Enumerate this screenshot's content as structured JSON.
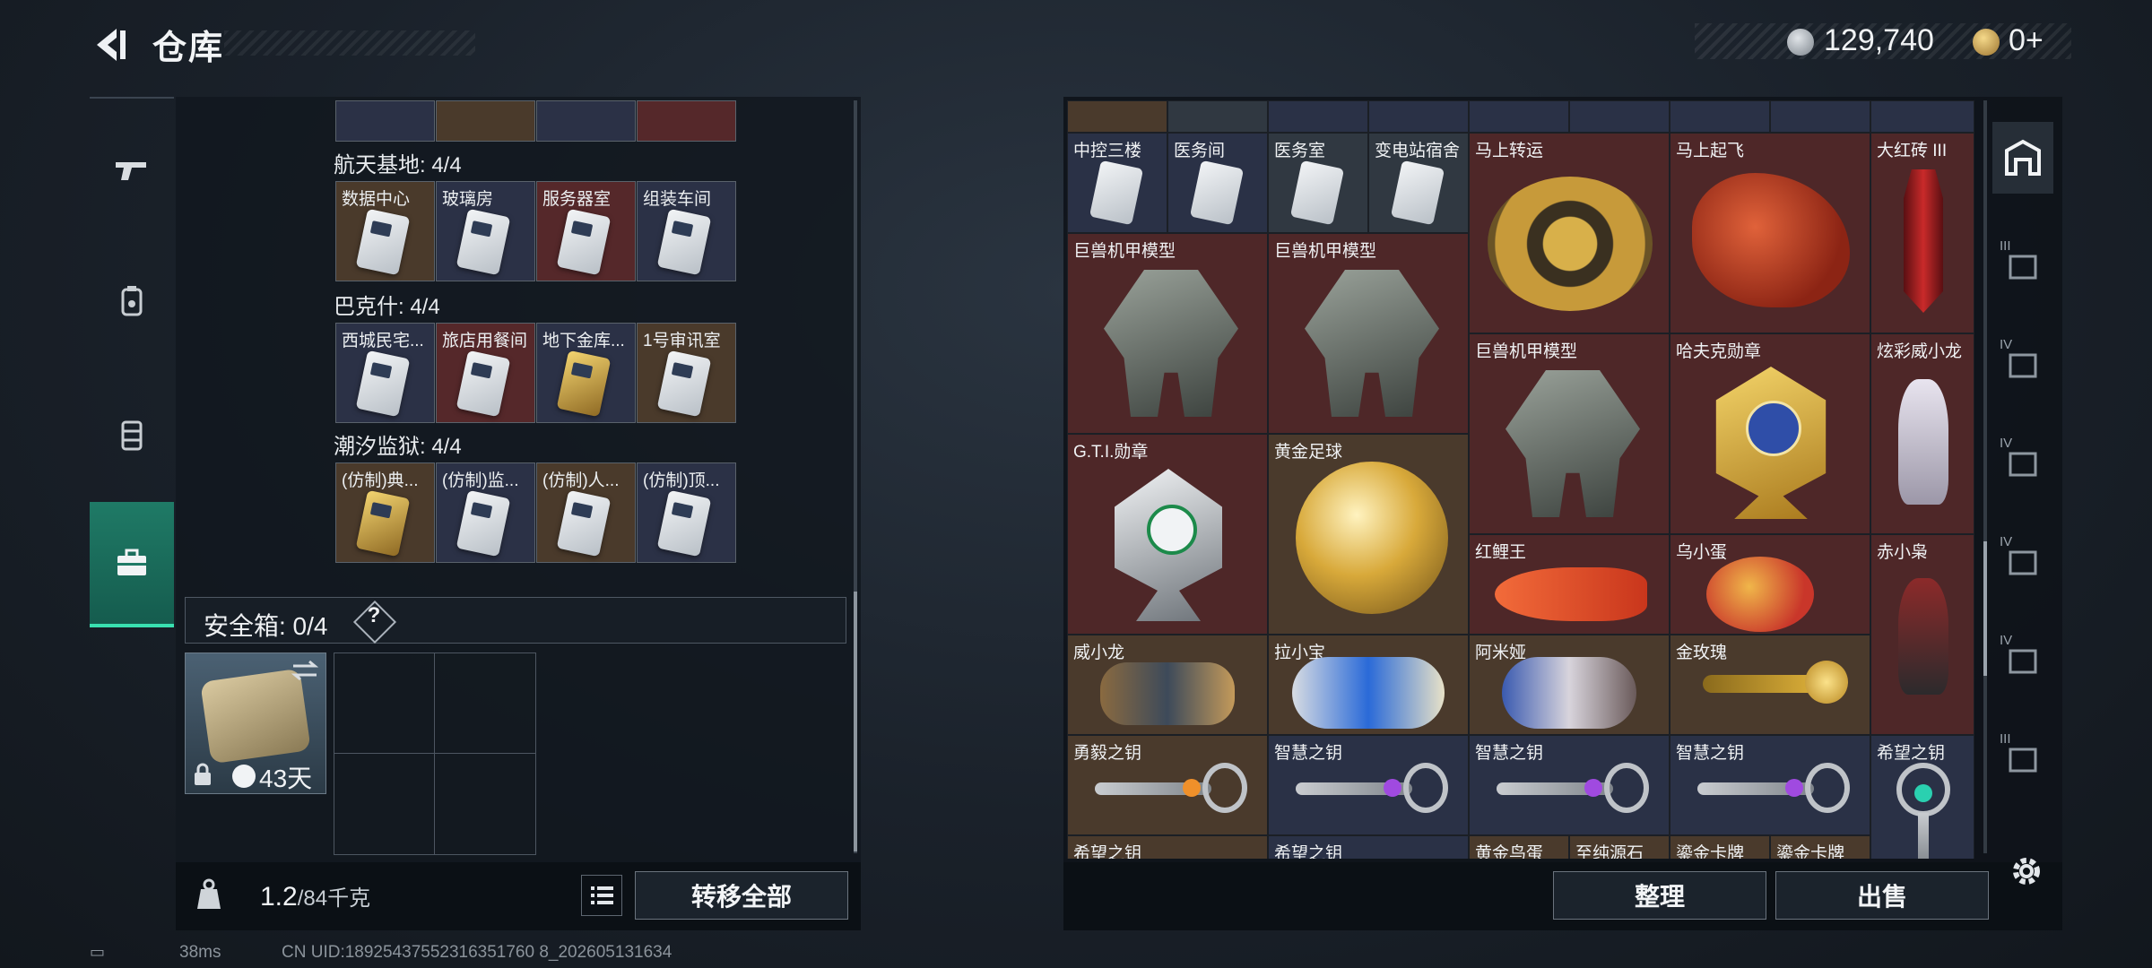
{
  "header": {
    "title": "仓库",
    "currency_primary": "129,740",
    "currency_secondary": "0+"
  },
  "nav": {
    "items": [
      {
        "name": "weapons-tab",
        "icon": "gun-icon"
      },
      {
        "name": "armor-tab",
        "icon": "backpack-icon"
      },
      {
        "name": "vest-tab",
        "icon": "vest-icon"
      },
      {
        "name": "items-tab",
        "icon": "briefcase-icon",
        "active": true
      }
    ]
  },
  "left": {
    "groups": [
      {
        "title": "航天基地: 4/4",
        "cards": [
          {
            "label": "数据中心",
            "bg": "brown"
          },
          {
            "label": "玻璃房",
            "bg": "navy"
          },
          {
            "label": "服务器室",
            "bg": "red"
          },
          {
            "label": "组装车间",
            "bg": "navy"
          }
        ]
      },
      {
        "title": "巴克什: 4/4",
        "cards": [
          {
            "label": "西城民宅...",
            "bg": "navy"
          },
          {
            "label": "旅店用餐间",
            "bg": "red"
          },
          {
            "label": "地下金库...",
            "bg": "navy",
            "gold": true
          },
          {
            "label": "1号审讯室",
            "bg": "brown"
          }
        ]
      },
      {
        "title": "潮汐监狱: 4/4",
        "cards": [
          {
            "label": "(仿制)典...",
            "bg": "brown",
            "gold": true
          },
          {
            "label": "(仿制)监...",
            "bg": "navy"
          },
          {
            "label": "(仿制)人...",
            "bg": "brown"
          },
          {
            "label": "(仿制)顶...",
            "bg": "navy"
          }
        ]
      }
    ],
    "safe_box_label": "安全箱: 0/4",
    "safe_help": "?",
    "safe_days": "43天",
    "weight_value": "1.2",
    "weight_unit": "/84千克",
    "transfer_all": "转移全部"
  },
  "right": {
    "items": [
      {
        "label": "中控三楼",
        "bg": "navy",
        "icon": "keycard-icon"
      },
      {
        "label": "医务间",
        "bg": "navy",
        "icon": "keycard-icon"
      },
      {
        "label": "医务室",
        "bg": "gray",
        "icon": "keycard-icon"
      },
      {
        "label": "变电站宿舍",
        "bg": "gray",
        "icon": "keycard-icon"
      },
      {
        "label": "马上转运",
        "bg": "red",
        "icon": "horse-wheel-icon"
      },
      {
        "label": "马上起飞",
        "bg": "red",
        "icon": "red-horse-icon"
      },
      {
        "label": "大红砖 III",
        "bg": "red",
        "icon": "red-brick-icon"
      },
      {
        "label": "巨兽机甲模型",
        "bg": "red",
        "icon": "mech-model-icon"
      },
      {
        "label": "巨兽机甲模型",
        "bg": "red",
        "icon": "mech-model-icon"
      },
      {
        "label": "巨兽机甲模型",
        "bg": "red",
        "icon": "mech-model-icon"
      },
      {
        "label": "哈夫克勋章",
        "bg": "red",
        "icon": "medal-icon"
      },
      {
        "label": "炫彩威小龙",
        "bg": "red",
        "icon": "figure-icon"
      },
      {
        "label": "G.T.I.勋章",
        "bg": "red",
        "icon": "gti-medal-icon"
      },
      {
        "label": "黄金足球",
        "bg": "brown",
        "icon": "gold-ball-icon"
      },
      {
        "label": "红鲤王",
        "bg": "red",
        "icon": "carp-icon"
      },
      {
        "label": "乌小蛋",
        "bg": "red",
        "icon": "egg-icon"
      },
      {
        "label": "赤小枭",
        "bg": "red",
        "icon": "owl-figure-icon"
      },
      {
        "label": "威小龙",
        "bg": "brown",
        "icon": "figure-icon"
      },
      {
        "label": "拉小宝",
        "bg": "brown",
        "icon": "figure-icon"
      },
      {
        "label": "阿米娅",
        "bg": "brown",
        "icon": "figure-icon"
      },
      {
        "label": "金玫瑰",
        "bg": "brown",
        "icon": "rose-icon"
      },
      {
        "label": "勇毅之钥",
        "bg": "brown",
        "icon": "key-icon"
      },
      {
        "label": "智慧之钥",
        "bg": "navy",
        "icon": "key-icon"
      },
      {
        "label": "智慧之钥",
        "bg": "navy",
        "icon": "key-icon"
      },
      {
        "label": "智慧之钥",
        "bg": "navy",
        "icon": "key-icon"
      },
      {
        "label": "希望之钥",
        "bg": "navy",
        "icon": "key-icon"
      },
      {
        "label": "希望之钥",
        "bg": "navy",
        "icon": "key-icon"
      },
      {
        "label": "希望之钥",
        "bg": "navy",
        "icon": "key-icon"
      },
      {
        "label": "黄金鸟蛋",
        "bg": "brown",
        "icon": "egg-icon"
      },
      {
        "label": "至纯源石",
        "bg": "brown",
        "icon": "stone-icon"
      },
      {
        "label": "鎏金卡牌",
        "bg": "brown",
        "icon": "card-icon"
      },
      {
        "label": "鎏金卡牌",
        "bg": "brown",
        "icon": "card-icon"
      }
    ],
    "side_tabs": [
      {
        "label": "",
        "icon": "container-icon"
      },
      {
        "label": "III",
        "icon": "backpack-slot-icon"
      },
      {
        "label": "IV",
        "icon": "backpack-slot-icon"
      },
      {
        "label": "IV",
        "icon": "backpack-slot-icon"
      },
      {
        "label": "IV",
        "icon": "backpack-slot-icon"
      },
      {
        "label": "IV",
        "icon": "backpack-slot-icon"
      },
      {
        "label": "III",
        "icon": "backpack-slot-icon"
      }
    ],
    "sort_label": "整理",
    "sell_label": "出售"
  },
  "status": {
    "ping": "38ms",
    "uid": "CN UID:18925437552316351760 8_202605131634"
  },
  "colors": {
    "accent": "#39e0b0",
    "red_cell": "#4e2728",
    "navy_cell": "#2a3146",
    "brown_cell": "#4a3a2c"
  }
}
